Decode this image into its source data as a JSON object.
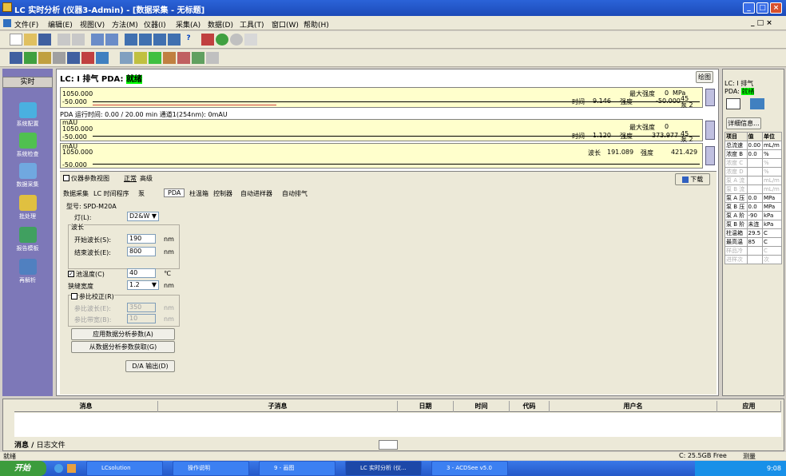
{
  "window": {
    "title": "LC 实时分析 (仪器3-Admin) - [数据采集 - 无标题]"
  },
  "menubar": {
    "items": [
      "文件(F)",
      "编辑(E)",
      "视图(V)",
      "方法(M)",
      "仪器(I)",
      "采集(A)",
      "数据(D)",
      "工具(T)",
      "窗口(W)",
      "帮助(H)"
    ]
  },
  "sidebar": {
    "header": "实时",
    "items": [
      "系统配置",
      "系统检查",
      "数据采集",
      "批处理",
      "报告模板",
      "再解析"
    ]
  },
  "status_header": {
    "lc_label": "LC:",
    "lc_value": "I 排气",
    "pda_label": "PDA:",
    "pda_value": "就绪",
    "draw_button": "绘图"
  },
  "graph1": {
    "ymax": "1050.000",
    "ymin": "-50.000",
    "unit": "mAU",
    "time_label": "时间",
    "time_value": "9.146",
    "intensity_label": "强度",
    "intensity_value": "-50.000",
    "max_label": "最大强度",
    "max_value": "0",
    "max_unit": "MPa",
    "pump_label": "泵 2",
    "right_value": "45"
  },
  "graph2_caption": "PDA 运行时间: 0.00 / 20.00 min 通道1(254nm): 0mAU",
  "graph2": {
    "ymax": "1050.000",
    "ymin": "-50.000",
    "unit": "mAU",
    "time_label": "时间",
    "time_value": "1.120",
    "intensity_label": "强度",
    "intensity_value": "373.977",
    "max_label": "最大强度",
    "max_value": "0",
    "pump_label": "泵 2",
    "right_value": "45"
  },
  "graph3": {
    "ymax": "1050.000",
    "ymin": "-50.000",
    "unit": "mAU",
    "wavelength_label": "波长",
    "wavelength_value": "191.089",
    "intensity_label": "强度",
    "intensity_value": "421.429"
  },
  "params": {
    "view_label": "仪器参数视图",
    "tab_normal": "正常",
    "tab_advanced": "高级",
    "download_button": "下载",
    "subtabs": [
      "数据采集",
      "LC 时间程序",
      "泵",
      "PDA",
      "柱温箱",
      "控制器",
      "自动进样器",
      "自动排气"
    ],
    "model": "型号: SPD-M20A",
    "lamp_label": "灯(L):",
    "lamp_value": "D2&W",
    "wavelength_group": "波长",
    "start_wl_label": "开始波长(S):",
    "start_wl_value": "190",
    "end_wl_label": "结束波长(E):",
    "end_wl_value": "800",
    "nm": "nm",
    "cell_temp_label": "池温度(C)",
    "cell_temp_value": "40",
    "cell_temp_unit": "℃",
    "slit_label": "狭缝宽度",
    "slit_value": "1.2",
    "ref_label": "参比校正(R)",
    "ref_wl_label": "参比波长(E):",
    "ref_wl_value": "350",
    "ref_bw_label": "参比带宽(B):",
    "ref_bw_value": "10",
    "apply_button": "应用数据分析参数(A)",
    "fetch_button": "从数据分析参数获取(G)",
    "da_button": "D/A 输出(D)"
  },
  "right_panel": {
    "lc_label": "LC:",
    "lc_value": "I 排气",
    "pda_label": "PDA:",
    "pda_value": "就绪",
    "details_button": "详细信息...",
    "table_headers": [
      "项目",
      "值",
      "单位"
    ],
    "rows": [
      [
        "总流速",
        "0.00",
        "mL/m"
      ],
      [
        "浓度 B",
        "0.0",
        "%"
      ],
      [
        "浓度 C",
        "",
        "%"
      ],
      [
        "浓度 D",
        "",
        "%"
      ],
      [
        "泵 A 流",
        "",
        "mL/m"
      ],
      [
        "泵 B 流",
        "",
        "mL/m"
      ],
      [
        "泵 A 压",
        "0.0",
        "MPa"
      ],
      [
        "泵 B 压",
        "0.0",
        "MPa"
      ],
      [
        "泵 A 阶",
        "-90",
        "kPa"
      ],
      [
        "泵 B 阶",
        "未连",
        "kPa"
      ],
      [
        "柱温箱",
        "29.5",
        "C"
      ],
      [
        "最高温",
        "85",
        "C"
      ],
      [
        "样品冷",
        "",
        "C"
      ],
      [
        "进样次",
        "",
        "次"
      ]
    ]
  },
  "log": {
    "headers": [
      "消息",
      "子消息",
      "日期",
      "时间",
      "代码",
      "用户名",
      "应用"
    ],
    "tab_message": "消息",
    "tab_log": "日志文件"
  },
  "statusbar": {
    "left": "就绪",
    "disk": "C: 25.5GB Free",
    "mode": "测量"
  },
  "taskbar": {
    "start": "开始",
    "tasks": [
      "LCsolution",
      "操作说明",
      "9 - 画图",
      "LC 实时分析 (仪...",
      "3 - ACDSee v5.0"
    ],
    "clock": "9:08"
  },
  "colors": {
    "title": "#1c4ab8",
    "sidebar": "#7d78b8",
    "graph_bg": "#ffffcc",
    "status_green": "#00ff00",
    "taskbar": "#2458c8"
  }
}
